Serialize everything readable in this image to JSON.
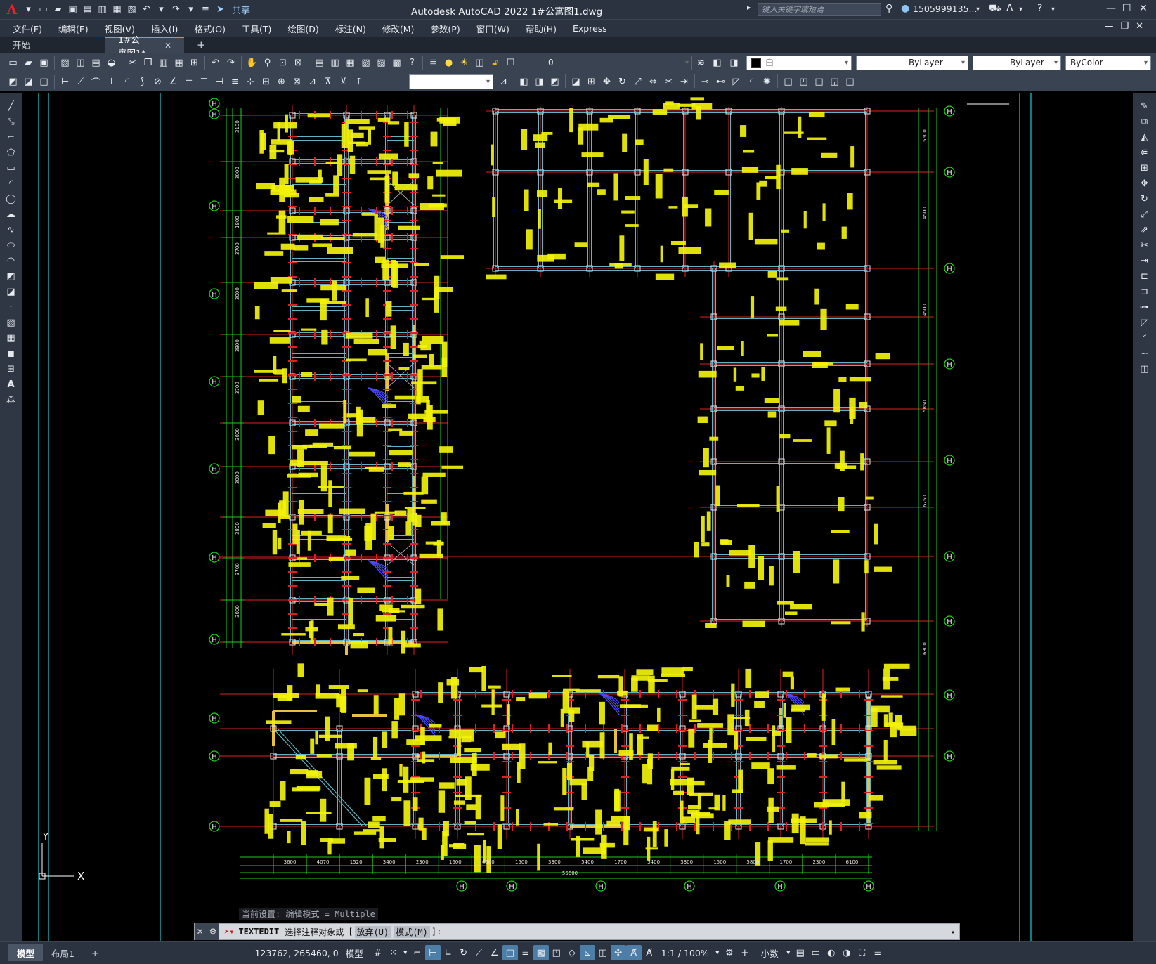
{
  "app": {
    "title": "Autodesk AutoCAD 2022    1#公寓图1.dwg",
    "share_label": "共享",
    "search_placeholder": "键入关键字或短语",
    "user_name": "1505999135...",
    "logo_letter": "A",
    "accent_color": "#60a8e8",
    "brand_color": "#e0252b"
  },
  "menu": [
    "文件(F)",
    "编辑(E)",
    "视图(V)",
    "插入(I)",
    "格式(O)",
    "工具(T)",
    "绘图(D)",
    "标注(N)",
    "修改(M)",
    "参数(P)",
    "窗口(W)",
    "帮助(H)",
    "Express"
  ],
  "tabs": [
    {
      "label": "开始"
    },
    {
      "label": "1#公寓图1*",
      "active": true
    }
  ],
  "toolbar": {
    "layer_value": "0",
    "color_value": "白",
    "linetype_value": "ByLayer",
    "lineweight_value": "ByLayer",
    "plotstyle_value": "ByColor"
  },
  "drawing": {
    "grid_bubble_label": "H",
    "overall_dimension": "55600",
    "dims_bottom": [
      "3600",
      "4070",
      "1520",
      "3400",
      "2300",
      "1600",
      "4500",
      "1500",
      "3300",
      "5400",
      "1700",
      "3400",
      "3300",
      "1500",
      "5800",
      "1700",
      "2300",
      "6100"
    ],
    "dims_left": [
      "3100",
      "3000",
      "1800",
      "3700",
      "3000",
      "3800",
      "3700",
      "3000",
      "3000",
      "3800",
      "3700",
      "3000"
    ],
    "dims_right": [
      "5600",
      "4500",
      "4500",
      "5850",
      "6750",
      "6300"
    ],
    "colors": {
      "grid": "#e02020",
      "dim": "#19d119",
      "beam": "#5fb3c4",
      "label": "#f2f20a",
      "column": "#e6e6e6",
      "wall": "#e8c040",
      "stair": "#4a4aff",
      "frame": "#18d0d8"
    }
  },
  "command": {
    "history": "当前设置: 编辑模式 = Multiple",
    "prompt_name": "TEXTEDIT",
    "prompt_text": "选择注释对象或",
    "option_1": "放弃(U)",
    "option_2": "模式(M)",
    "prompt_end": "]:"
  },
  "ucs": {
    "y_label": "Y",
    "x_label": "X"
  },
  "status": {
    "model_tab": "模型",
    "layout_tab": "布局1",
    "coords": "123762, 265460, 0",
    "space": "模型",
    "scale": "1:1 / 100%",
    "units": "小数"
  }
}
